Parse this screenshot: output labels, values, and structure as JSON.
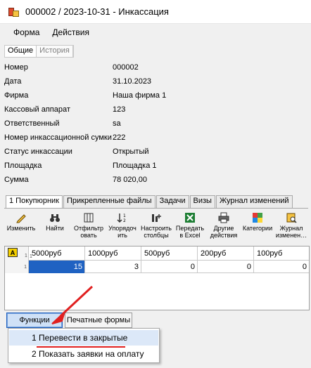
{
  "window": {
    "title": "000002 / 2023-10-31 - Инкассация"
  },
  "menu": {
    "items": [
      "Форма",
      "Действия"
    ]
  },
  "top_tabs": [
    "Общие",
    "История"
  ],
  "fields": [
    {
      "label": "Номер",
      "value": "000002"
    },
    {
      "label": "Дата",
      "value": "31.10.2023"
    },
    {
      "label": "Фирма",
      "value": "Наша фирма 1"
    },
    {
      "label": "Кассовый аппарат",
      "value": "123"
    },
    {
      "label": "Ответственный",
      "value": "sa"
    },
    {
      "label": "Номер инкассационной сумки",
      "value": "222"
    },
    {
      "label": "Статус инкассации",
      "value": "Открытый"
    },
    {
      "label": "Площадка",
      "value": "Площадка 1"
    },
    {
      "label": "Сумма",
      "value": "78 020,00"
    }
  ],
  "bottom_tabs": [
    "1 Покупюрник",
    "Прикрепленные файлы",
    "Задачи",
    "Визы",
    "Журнал изменений"
  ],
  "toolbar": [
    {
      "label": "Изменить",
      "icon": "pencil-icon"
    },
    {
      "label": "Найти",
      "icon": "binoculars-icon"
    },
    {
      "label": "Отфильтр\nовать",
      "icon": "filter-icon"
    },
    {
      "label": "Упорядоч\nить",
      "icon": "sort-icon"
    },
    {
      "label": "Настроить\nстолбцы",
      "icon": "columns-icon"
    },
    {
      "label": "Передать\nв Excel",
      "icon": "excel-icon"
    },
    {
      "label": "Другие\nдействия",
      "icon": "printer-icon"
    },
    {
      "label": "Категории",
      "icon": "categories-icon"
    },
    {
      "label": "Журнал\nизменен…",
      "icon": "journal-icon"
    }
  ],
  "grid": {
    "corner_badge": "A",
    "corner_num": "1",
    "columns": [
      "5000руб",
      "1000руб",
      "500руб",
      "200руб",
      "100руб"
    ],
    "column_nums": [
      "1",
      "",
      "",
      "",
      ""
    ],
    "rows": [
      {
        "num": "1",
        "values": [
          "15",
          "3",
          "0",
          "0",
          "0"
        ]
      }
    ]
  },
  "buttons": {
    "functions": "Функции",
    "print_forms": "Печатные формы"
  },
  "dropdown": {
    "items": [
      "1 Перевести в закрытые",
      "2 Показать заявки на оплату"
    ]
  },
  "colors": {
    "selection": "#1f62c2",
    "highlight": "#dce8f8",
    "annotation": "#e02020"
  }
}
